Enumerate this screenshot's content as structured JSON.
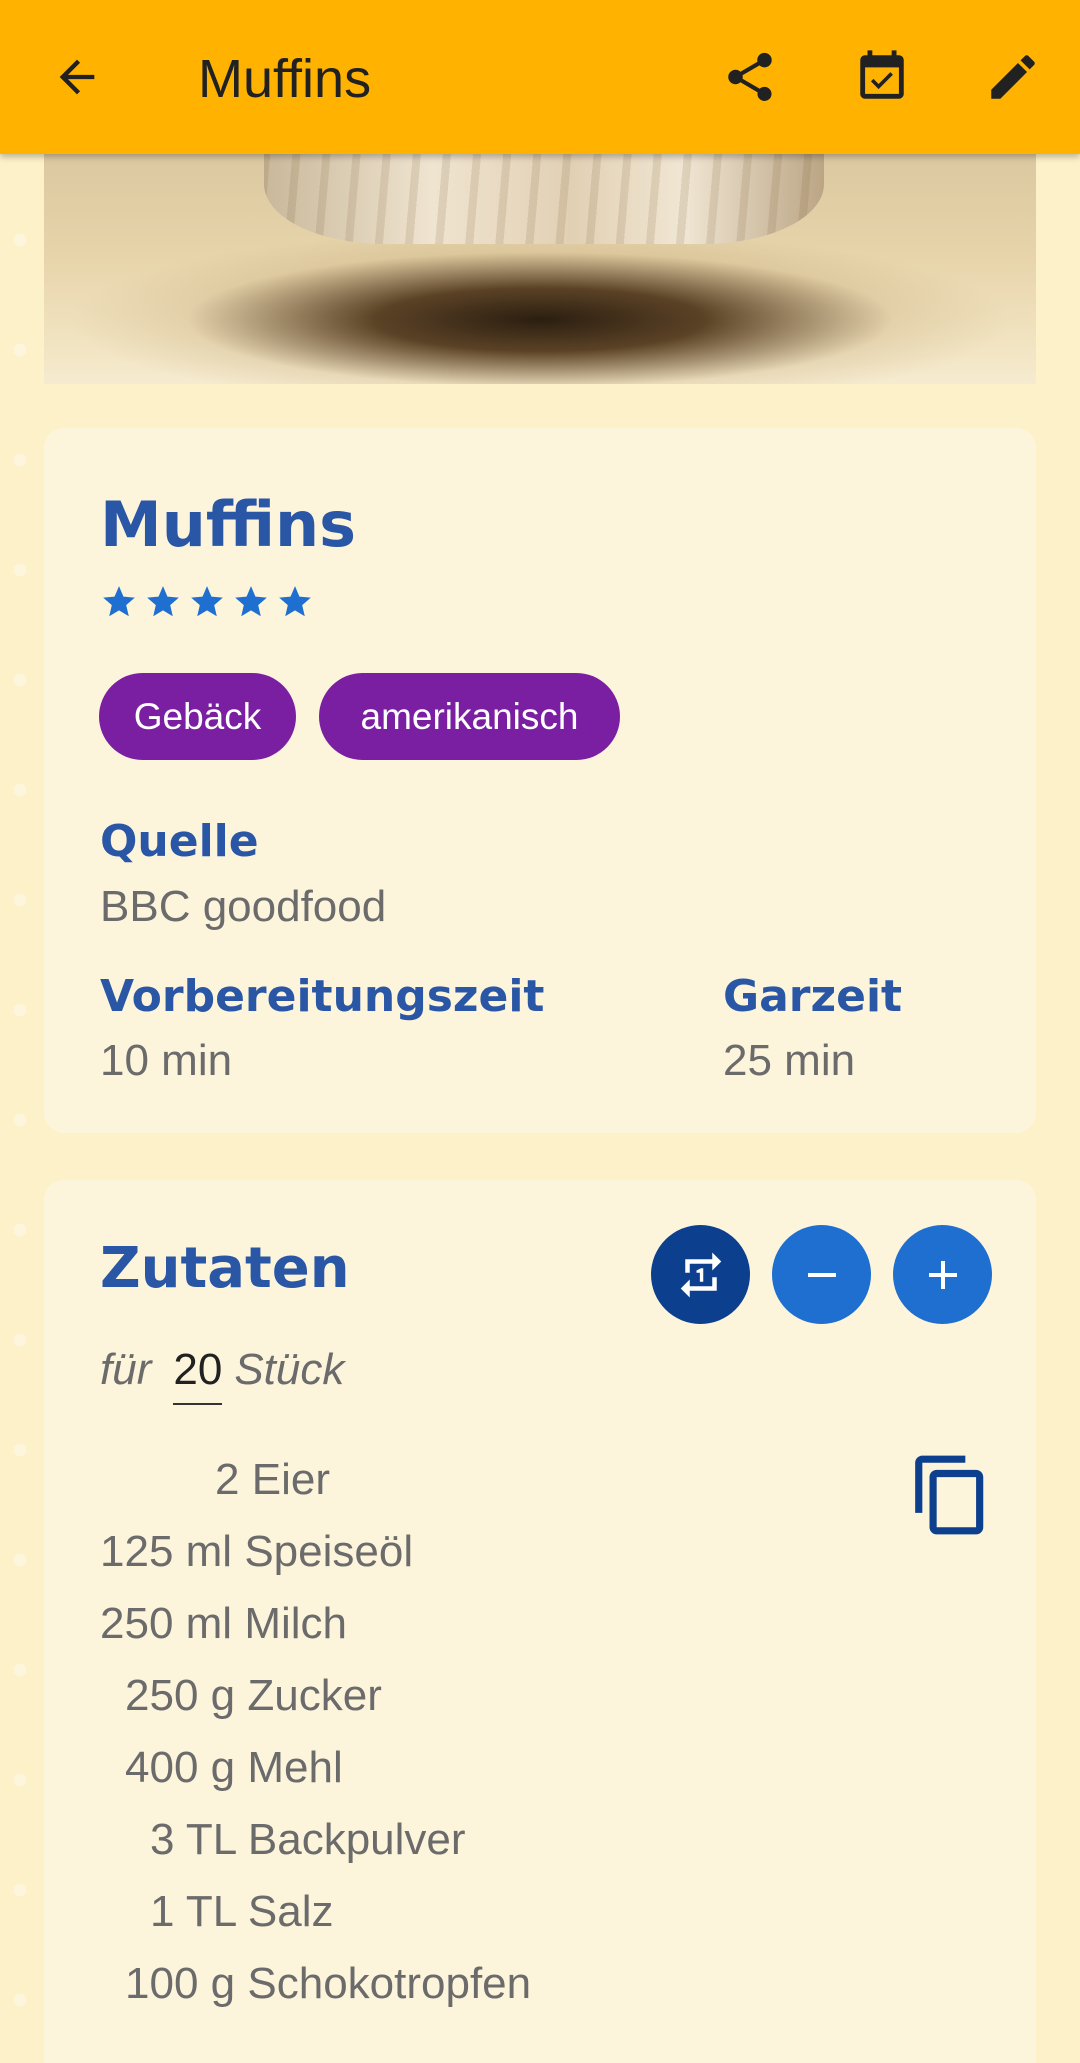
{
  "appbar": {
    "title": "Muffins",
    "icons": [
      "back-arrow-icon",
      "share-icon",
      "calendar-check-icon",
      "edit-pencil-icon"
    ]
  },
  "recipe": {
    "title": "Muffins",
    "rating": 5,
    "rating_max": 5,
    "tags": [
      "Gebäck",
      "amerikanisch"
    ],
    "source_label": "Quelle",
    "source_value": "BBC goodfood",
    "prep_label": "Vorbereitungszeit",
    "prep_value": "10 min",
    "cook_label": "Garzeit",
    "cook_value": "25 min"
  },
  "ingredients": {
    "title": "Zutaten",
    "servings_prefix": "für",
    "servings_value": "20",
    "servings_unit": "Stück",
    "items": [
      {
        "qty": "2",
        "unit": "",
        "name": "Eier"
      },
      {
        "qty": "125",
        "unit": "ml",
        "name": "Speiseöl"
      },
      {
        "qty": "250",
        "unit": "ml",
        "name": "Milch"
      },
      {
        "qty": "250",
        "unit": "g",
        "name": "Zucker"
      },
      {
        "qty": "400",
        "unit": "g",
        "name": "Mehl"
      },
      {
        "qty": "3",
        "unit": "TL",
        "name": "Backpulver"
      },
      {
        "qty": "1",
        "unit": "TL",
        "name": "Salz"
      },
      {
        "qty": "100",
        "unit": "g",
        "name": "Schokotropfen"
      }
    ]
  },
  "colors": {
    "appbar": "#ffb300",
    "accent_blue": "#2a56a6",
    "chip_purple": "#7b1fa2",
    "button_blue": "#1e6fcf",
    "button_dark_blue": "#0d3f8f"
  }
}
